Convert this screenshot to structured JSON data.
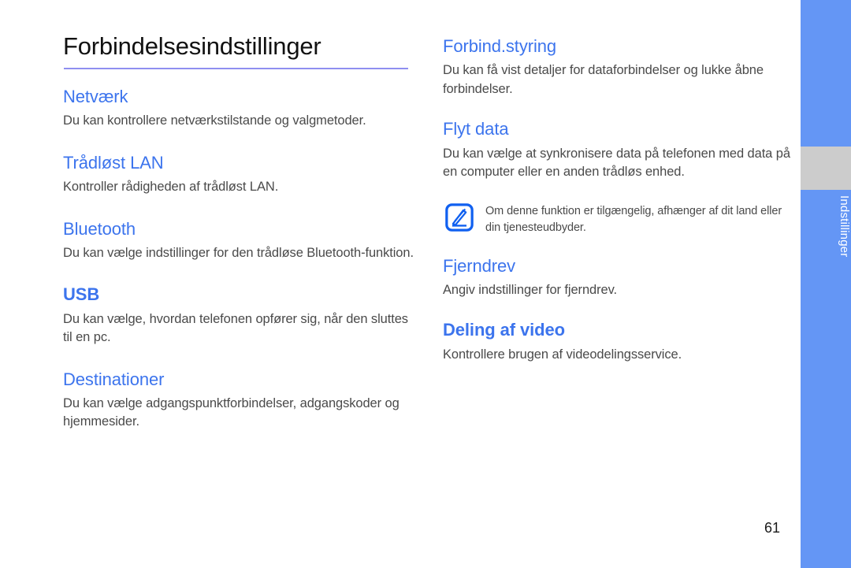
{
  "page": {
    "title": "Forbindelsesindstillinger",
    "number": "61",
    "accent_blue": "#3c74ed",
    "rule_color": "#8f8ff0",
    "tab_color": "#6496f5",
    "tab_gap_color": "#cccccc",
    "body_color": "#4a4a4a"
  },
  "edge_tab": {
    "label": "Indstillinger"
  },
  "left_column": {
    "sections": [
      {
        "heading": "Netværk",
        "body": "Du kan kontrollere netværkstilstande og valgmetoder.",
        "bold": false
      },
      {
        "heading": "Trådløst LAN",
        "body": "Kontroller rådigheden af trådløst LAN.",
        "bold": false
      },
      {
        "heading": "Bluetooth",
        "body": "Du kan vælge indstillinger for den trådløse Bluetooth-funktion.",
        "bold": false
      },
      {
        "heading": "USB",
        "body": "Du kan vælge, hvordan telefonen opfører sig, når den sluttes til en pc.",
        "bold": true
      },
      {
        "heading": "Destinationer",
        "body": "Du kan vælge adgangspunktforbindelser, adgangskoder og hjemmesider.",
        "bold": false
      }
    ]
  },
  "right_column": {
    "sections_top": [
      {
        "heading": "Forbind.styring",
        "body": "Du kan få vist detaljer for dataforbindelser og lukke åbne forbindelser.",
        "bold": false
      },
      {
        "heading": "Flyt data",
        "body": "Du kan vælge at synkronisere data på telefonen med data på en computer eller en anden trådløs enhed.",
        "bold": false
      }
    ],
    "note": {
      "icon": "note-pen-icon",
      "text": "Om denne funktion er tilgængelig, afhænger af dit land eller din tjenesteudbyder."
    },
    "sections_bottom": [
      {
        "heading": "Fjerndrev",
        "body": "Angiv indstillinger for fjerndrev.",
        "bold": false
      },
      {
        "heading": "Deling af video",
        "body": "Kontrollere brugen af videodelingsservice.",
        "bold": true
      }
    ]
  }
}
